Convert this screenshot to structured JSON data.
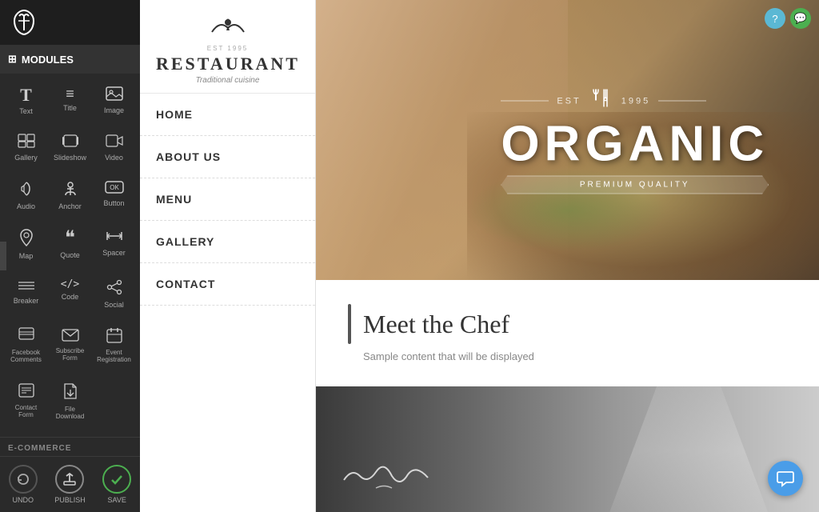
{
  "topbar": {
    "help_icon": "?",
    "chat_icon": "💬",
    "help_bg": "#5bb8d4",
    "chat_bg": "#4caf50"
  },
  "left_panel": {
    "modules_label": "MODULES",
    "collapse_icon": "‹",
    "modules": [
      {
        "id": "text",
        "icon": "T",
        "label": "Text"
      },
      {
        "id": "title",
        "icon": "≡",
        "label": "Title"
      },
      {
        "id": "image",
        "icon": "🖼",
        "label": "Image"
      },
      {
        "id": "gallery",
        "icon": "⊞",
        "label": "Gallery"
      },
      {
        "id": "slideshow",
        "icon": "▣",
        "label": "Slideshow"
      },
      {
        "id": "video",
        "icon": "💾",
        "label": "Video"
      },
      {
        "id": "audio",
        "icon": "♪",
        "label": "Audio"
      },
      {
        "id": "anchor",
        "icon": "⚓",
        "label": "Anchor"
      },
      {
        "id": "button",
        "icon": "OK",
        "label": "Button"
      },
      {
        "id": "map",
        "icon": "📍",
        "label": "Map"
      },
      {
        "id": "quote",
        "icon": "❝",
        "label": "Quote"
      },
      {
        "id": "spacer",
        "icon": "⇔",
        "label": "Spacer"
      },
      {
        "id": "breaker",
        "icon": "≋",
        "label": "Breaker"
      },
      {
        "id": "code",
        "icon": "</>",
        "label": "Code"
      },
      {
        "id": "social",
        "icon": "⬡",
        "label": "Social"
      },
      {
        "id": "facebook",
        "icon": "▤",
        "label": "Facebook Comments"
      },
      {
        "id": "subscribe",
        "icon": "✉",
        "label": "Subscribe Form"
      },
      {
        "id": "event",
        "icon": "📅",
        "label": "Event Registration"
      },
      {
        "id": "contact",
        "icon": "📋",
        "label": "Contact Form"
      },
      {
        "id": "file",
        "icon": "⬇",
        "label": "File Download"
      }
    ],
    "ecommerce_label": "E-COMMERCE",
    "bottom_buttons": [
      {
        "id": "undo",
        "icon": "↩",
        "label": "UNDO"
      },
      {
        "id": "publish",
        "icon": "🏠",
        "label": "PUBLISH"
      },
      {
        "id": "save",
        "icon": "✓",
        "label": "SAVE"
      }
    ]
  },
  "nav_panel": {
    "logo_est": "EST      1995",
    "logo_name": "RESTAURANT",
    "logo_subtitle": "Traditional cuisine",
    "logo_bird": "𝓡",
    "nav_items": [
      {
        "id": "home",
        "label": "HOME"
      },
      {
        "id": "about",
        "label": "ABOUT US"
      },
      {
        "id": "menu",
        "label": "MENU"
      },
      {
        "id": "gallery",
        "label": "GALLERY"
      },
      {
        "id": "contact",
        "label": "CONTACT"
      }
    ]
  },
  "hero": {
    "est_left": "EST",
    "year": "1995",
    "title": "ORGANIC",
    "badge": "PREMIUM QUALITY"
  },
  "chef_section": {
    "title": "Meet the Chef",
    "subtitle": "Sample content that will be displayed"
  },
  "chat_fab_icon": "💬"
}
